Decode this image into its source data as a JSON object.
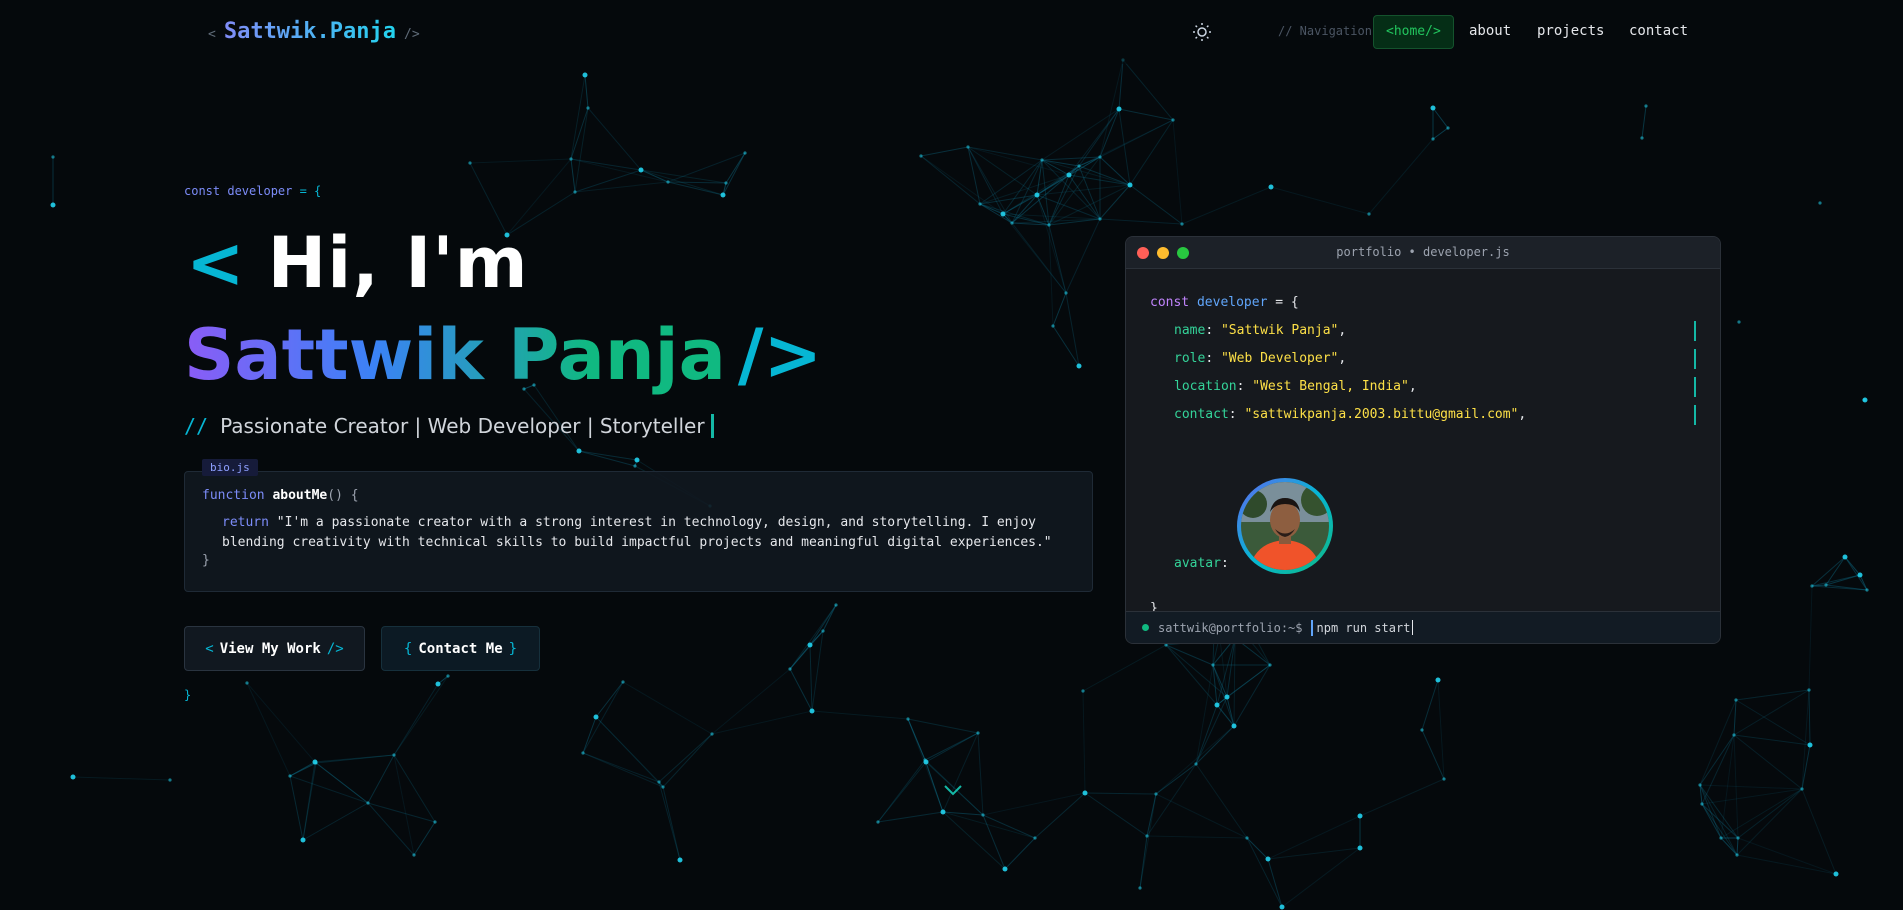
{
  "header": {
    "logo_open": "<",
    "logo_name": "Sattwik.Panja",
    "logo_close": "/>",
    "theme_icon": "sun-icon",
    "nav_comment": "// Navigation",
    "nav": [
      {
        "label": "<home/>",
        "active": true
      },
      {
        "label": "about"
      },
      {
        "label": "projects"
      },
      {
        "label": "contact"
      }
    ]
  },
  "hero": {
    "const_line_kw": "const developer",
    "const_line_rest": " = {",
    "hi_bracket": "<",
    "hi_text": "Hi, I'm",
    "name": "Sattwik Panja",
    "name_close": "/>",
    "tagline_prefix": "//",
    "tagline": "Passionate Creator | Web Developer | Storyteller",
    "bio_tab": "bio.js",
    "bio_fn_kw": "function",
    "bio_fn_name": "aboutMe",
    "bio_fn_sig": "() {",
    "bio_return": "return",
    "bio_text_1": "\"I'm a passionate creator with a strong interest in technology, design, and storytelling. I enjoy",
    "bio_text_2": "blending creativity with technical skills to build impactful projects and meaningful digital experiences.\"",
    "bio_close": "}",
    "btn_work_open": "<",
    "btn_work_label": "View My Work",
    "btn_work_close": "/>",
    "btn_contact_open": "{",
    "btn_contact_label": "Contact Me",
    "btn_contact_close": "}",
    "closing_brace": "}"
  },
  "editor": {
    "title": "portfolio • developer.js",
    "line1_kw": "const",
    "line1_var": "developer",
    "line1_rest": " = {",
    "fields": [
      {
        "key": "name",
        "value": "\"Sattwik Panja\""
      },
      {
        "key": "role",
        "value": "\"Web Developer\""
      },
      {
        "key": "location",
        "value": "\"West Bengal, India\""
      },
      {
        "key": "contact",
        "value": "\"sattwikpanja.2003.bittu@gmail.com\""
      }
    ],
    "avatar_key": "avatar",
    "closing": "}",
    "terminal_prompt": "sattwik@portfolio:~$",
    "terminal_cmd": "npm run start",
    "colors": {
      "red": "#ff5f57",
      "yellow": "#febc2e",
      "green": "#28c840"
    }
  },
  "scroll_icon": "chevron-down-icon"
}
